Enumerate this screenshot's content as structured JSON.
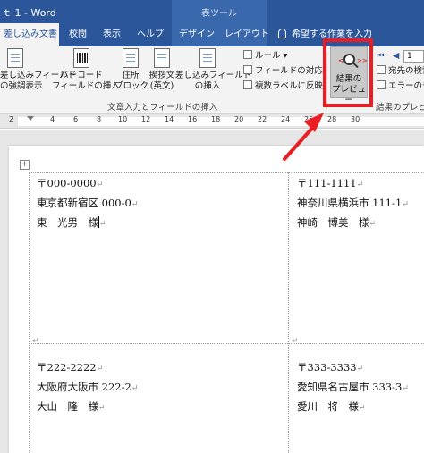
{
  "titlebar": {
    "doc_title": "ｔ 1  -  Word",
    "context_group": "表ツール"
  },
  "tabs": {
    "active": "差し込み文書",
    "items": [
      "校閲",
      "表示",
      "ヘルプ",
      "デザイン",
      "レイアウト"
    ],
    "tell_me": "希望する作業を入力"
  },
  "ribbon": {
    "highlight_fields": [
      "差し込みフィールド",
      "の強調表示"
    ],
    "barcode_field": [
      "バーコード",
      "フィールドの挿入"
    ],
    "address_block": [
      "住所",
      "ブロック"
    ],
    "greeting_line": [
      "挨拶文",
      "(英文)"
    ],
    "insert_merge_field": [
      "差し込みフィールド",
      "の挿入"
    ],
    "rules": "ルール",
    "match_fields": "フィールドの対応",
    "update_labels": "複数ラベルに反映",
    "group_write_insert": "文章入力とフィールドの挿入",
    "preview_results": [
      "結果の",
      "プレビュー"
    ],
    "record_number": "1",
    "find_recipient": "宛先の検索",
    "check_errors": "エラーのチェ",
    "group_preview": "結果のプレビュー"
  },
  "ruler": {
    "numbers": [
      "2",
      "2",
      "4",
      "6",
      "8",
      "10",
      "12",
      "14",
      "16",
      "18",
      "20",
      "22",
      "24",
      "26",
      "28",
      "30"
    ]
  },
  "labels": [
    {
      "postal": "〒000-0000",
      "address": "東京都新宿区 000-0",
      "name": "東　光男　様"
    },
    {
      "postal": "〒111-1111",
      "address": "神奈川県横浜市 111-1",
      "name": "神崎　博美　様"
    },
    {
      "postal": "〒222-2222",
      "address": "大阪府大阪市 222-2",
      "name": "大山　隆　様"
    },
    {
      "postal": "〒333-3333",
      "address": "愛知県名古屋市 333-3",
      "name": "愛川　将　様"
    }
  ],
  "marks": {
    "paragraph": "↵",
    "table_move": "+"
  },
  "colors": {
    "accent": "#2b579a",
    "highlight": "#ea1c24"
  }
}
